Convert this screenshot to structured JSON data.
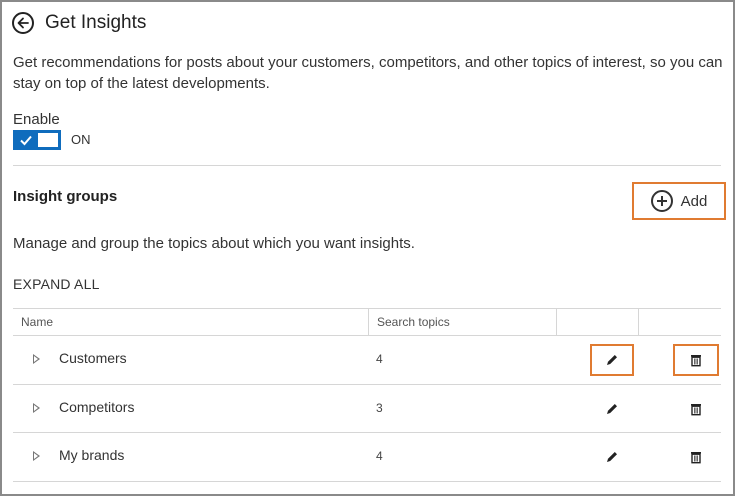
{
  "header": {
    "title": "Get Insights",
    "back_icon": "circle-arrow-left-icon"
  },
  "description": "Get recommendations for posts about your customers, competitors, and other topics of interest, so you can stay on top of the latest developments.",
  "enable": {
    "label": "Enable",
    "state": "ON",
    "on": true,
    "color": "#0f6cbd"
  },
  "insight_groups": {
    "title": "Insight groups",
    "add_label": "Add",
    "description": "Manage and group the topics about which you want insights.",
    "expand_all": "EXPAND ALL",
    "columns": [
      "Name",
      "Search topics",
      "",
      ""
    ],
    "rows": [
      {
        "name": "Customers",
        "count": "4",
        "highlighted": true
      },
      {
        "name": "Competitors",
        "count": "3",
        "highlighted": false
      },
      {
        "name": "My brands",
        "count": "4",
        "highlighted": false
      }
    ],
    "highlight_color": "#e07b31"
  }
}
